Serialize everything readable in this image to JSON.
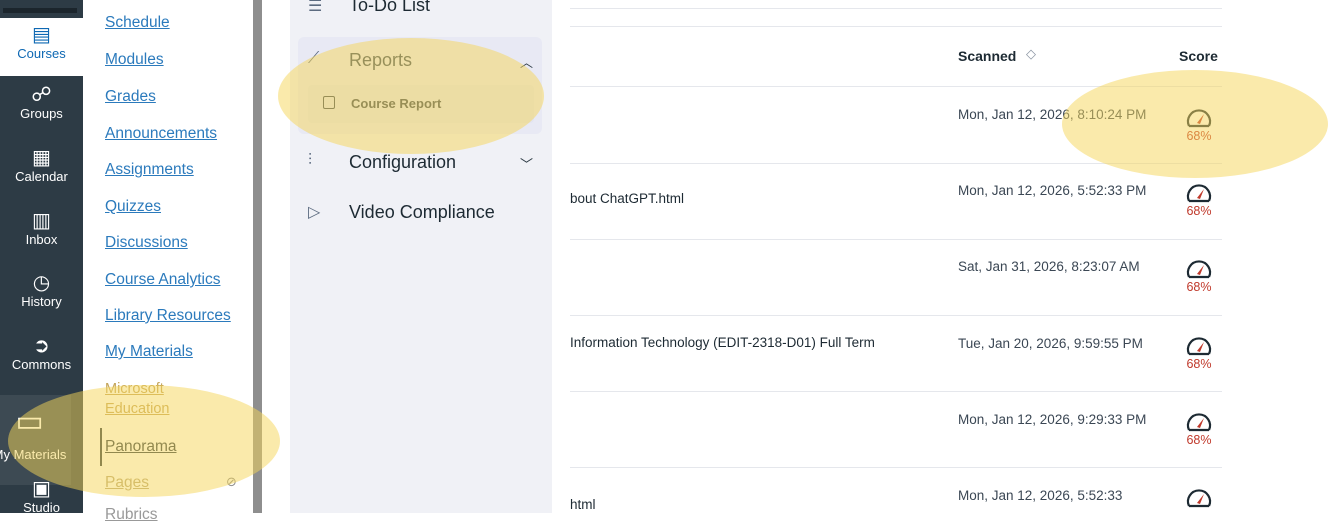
{
  "global_nav": {
    "items": [
      {
        "label": "Courses",
        "icon": "book-icon",
        "glyph": "▤"
      },
      {
        "label": "Groups",
        "icon": "groups-icon",
        "glyph": "☍"
      },
      {
        "label": "Calendar",
        "icon": "calendar-icon",
        "glyph": "▦"
      },
      {
        "label": "Inbox",
        "icon": "inbox-icon",
        "glyph": "▥"
      },
      {
        "label": "History",
        "icon": "history-icon",
        "glyph": "◷"
      },
      {
        "label": "Commons",
        "icon": "commons-icon",
        "glyph": "➲"
      },
      {
        "label": "My Materials",
        "icon": "materials-icon",
        "glyph": "▭"
      },
      {
        "label": "Studio",
        "icon": "studio-icon",
        "glyph": "▣"
      }
    ]
  },
  "course_nav": {
    "items": [
      "Schedule",
      "Modules",
      "Grades",
      "Announcements",
      "Assignments",
      "Quizzes",
      "Discussions",
      "Course Analytics",
      "Library Resources",
      "My Materials",
      "Microsoft",
      "Education",
      "Panorama",
      "Pages",
      "Rubrics"
    ]
  },
  "tool_nav": {
    "todo": "To-Do List",
    "reports": "Reports",
    "course_report": "Course Report",
    "configuration": "Configuration",
    "video_compliance": "Video Compliance"
  },
  "table": {
    "headers": {
      "scanned": "Scanned",
      "score": "Score"
    },
    "rows": [
      {
        "title": "",
        "date": "Mon, Jan 12, 2026, 8:10:24 PM",
        "score": "68%"
      },
      {
        "title": "bout ChatGPT.html",
        "date": "Mon, Jan 12, 2026, 5:52:33 PM",
        "score": "68%"
      },
      {
        "title": "",
        "date": "Sat, Jan 31, 2026, 8:23:07 AM",
        "score": "68%"
      },
      {
        "title": "Information Technology (EDIT-2318-D01) Full Term",
        "date": "Tue, Jan 20, 2026, 9:59:55 PM",
        "score": "68%"
      },
      {
        "title": "",
        "date": "Mon, Jan 12, 2026, 9:29:33 PM",
        "score": "68%"
      },
      {
        "title": "html",
        "date": "Mon, Jan 12, 2026, 5:52:33",
        "score": ""
      }
    ]
  },
  "colors": {
    "nav_bg": "#2d3b45",
    "link": "#2b7abc",
    "score": "#c0392b",
    "highlight": "#f6d558"
  }
}
